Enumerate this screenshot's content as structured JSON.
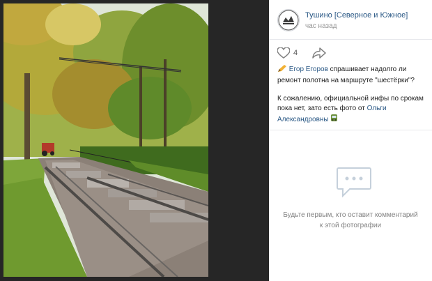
{
  "post": {
    "group_name": "Тушино [Северное и Южное]",
    "time": "час назад",
    "likes": "4"
  },
  "caption": {
    "author": "Егор Егоров",
    "line1_rest": " спрашивает надолго ли ремонт полотна на маршруте \"шестёрки\"?",
    "line2_start": "К сожалению, официальной инфы по срокам пока нет, зато есть фото от ",
    "photo_author": "Ольги Александровны"
  },
  "comments": {
    "empty_text": "Будьте первым, кто оставит комментарий к этой фотографии"
  },
  "colors": {
    "link": "#2a5885",
    "muted": "#939393",
    "background": "#232323"
  },
  "icons": [
    "heart-icon",
    "share-icon",
    "pencil-emoji",
    "tram-emoji",
    "comment-bubble-icon"
  ]
}
